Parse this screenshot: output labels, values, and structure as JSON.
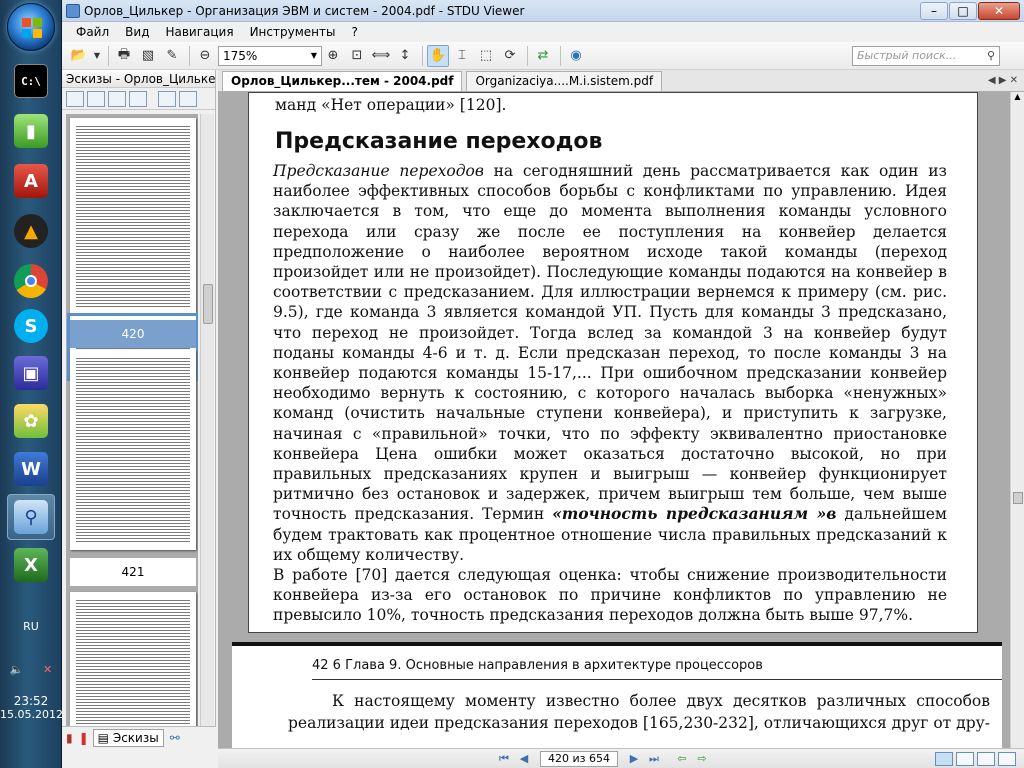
{
  "taskbar": {
    "lang": "RU",
    "time": "23:52",
    "date": "15.05.2012"
  },
  "window": {
    "title": "Орлов_Цилькер - Организация ЭВМ и систем - 2004.pdf - STDU Viewer",
    "min": "–",
    "max": "□",
    "close": "✕"
  },
  "menu": [
    "Файл",
    "Вид",
    "Навигация",
    "Инструменты",
    "?"
  ],
  "toolbar": {
    "zoom": "175%",
    "search_placeholder": "Быстрый поиск..."
  },
  "leftpanel": {
    "title": "Эскизы - Орлов_Цилькер -",
    "thumb_pages": [
      "420",
      "421"
    ],
    "bottom_tab": "Эскизы"
  },
  "tabs": [
    {
      "label": "Орлов_Цилькер...тем - 2004.pdf",
      "active": true
    },
    {
      "label": "Organizaciya....M.i.sistem.pdf",
      "active": false
    }
  ],
  "page1": {
    "top_line": "манд «Нет операции» [120].",
    "heading": "Предсказание переходов",
    "lead_italic": "Предсказание переходов",
    "para1": " на сегодняшний день рассматривается как один из наиболее эффективных способов борьбы с конфликтами по управлению. Идея заключается в том, что еще до момента выполнения команды условного перехода или сразу же после ее поступления на конвейер делается предположение о наиболее вероятном исходе такой команды (переход произойдет или не произойдет). Последующие команды подаются на конвейер в соответствии с предсказанием. Для иллюстрации вернемся к примеру (см. рис. 9.5), где команда 3 является командой УП. Пусть для команды 3 предсказано, что переход не произойдет. Тогда вслед за командой 3 на конвейер будут поданы команды 4-6 и т. д. Если предсказан переход, то после команды 3 на конвейер подаются команды 15-17,... При ошибочном предсказании конвейер необходимо вернуть к состоянию, с которого началась выборка «ненужных» команд (очистить начальные ступени конвейера), и приступить к загрузке, начиная с «правильной» точки, что по эффекту эквивалентно приостановке конвейера Цена ошибки может оказаться достаточно высокой, но при правильных предсказаниях крупен и выигрыш — конвейер функционирует ритмично без остановок и задержек, причем выигрыш тем больше, чем выше точность предсказания. Термин ",
    "term_italic": "«точность предсказаниям »в",
    "para1_end": " дальнейшем будем трактовать как процентное отношение числа правильных предсказаний к их общему количеству.",
    "para2": "В работе [70] дается следующая оценка: чтобы снижение производительности конвейера из-за его остановок по причине конфликтов по управлению не превысило 10%, точность предсказания переходов должна быть выше 97,7%."
  },
  "page2": {
    "header": "42 6 Глава 9. Основные направления в архитектуре процессоров",
    "text": "К настоящему моменту известно более двух десятков различных способов реализации идеи предсказания переходов [165,230-232], отличающихся друг от дру-"
  },
  "status": {
    "page": "420 из 654"
  }
}
